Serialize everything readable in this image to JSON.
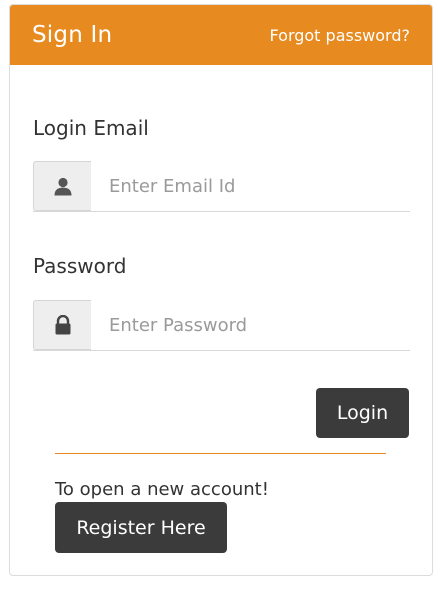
{
  "header": {
    "title": "Sign In",
    "forgot_link": "Forgot password?"
  },
  "form": {
    "email": {
      "label": "Login Email",
      "placeholder": "Enter Email Id",
      "icon": "user-icon"
    },
    "password": {
      "label": "Password",
      "placeholder": "Enter Password",
      "icon": "lock-icon"
    },
    "login_button": "Login"
  },
  "register": {
    "text": "To open a new account!",
    "button": "Register Here"
  },
  "colors": {
    "accent": "#e78b20",
    "button": "#3b3b3b"
  }
}
